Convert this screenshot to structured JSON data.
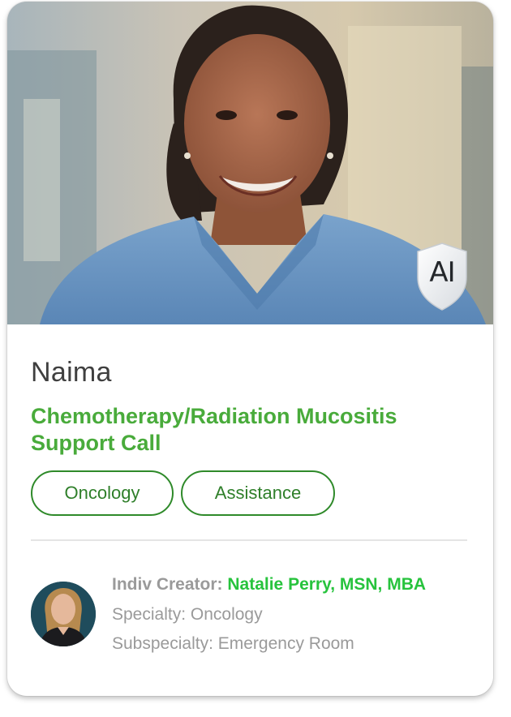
{
  "card": {
    "name": "Naima",
    "title": "Chemotherapy/Radiation Mucositis Support Call",
    "badge": "AI",
    "tags": [
      "Oncology",
      "Assistance"
    ],
    "creator": {
      "label": "Indiv Creator:",
      "name": "Natalie Perry, MSN, MBA",
      "specialty": "Specialty: Oncology",
      "subspecialty": "Subspecialty: Emergency Room"
    }
  },
  "images": {
    "hero": "portrait-photo-nurse-in-blue-scrubs",
    "avatar": "creator-avatar-photo"
  },
  "colors": {
    "accent_green": "#49ab3b",
    "tag_border": "#2f8a2a",
    "creator_green": "#27c33d",
    "muted_text": "#9a9a9a",
    "scrubs": "#6a96c4"
  }
}
